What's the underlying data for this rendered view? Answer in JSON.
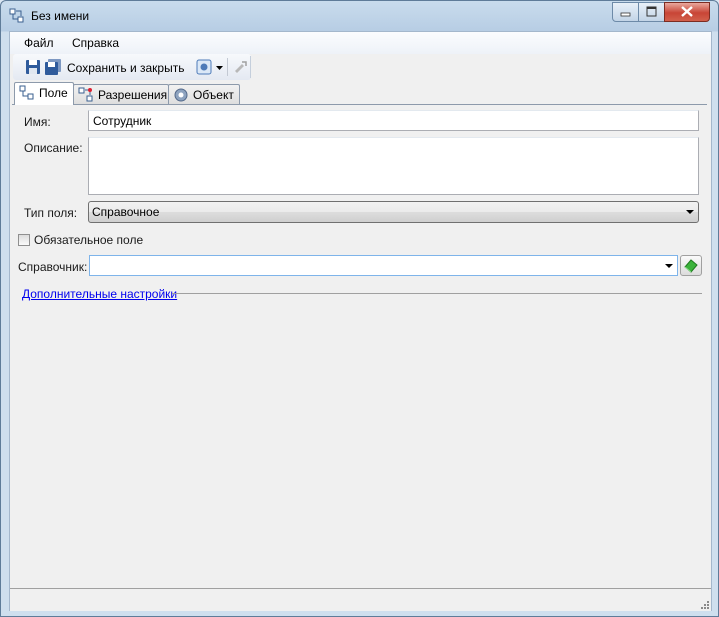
{
  "window": {
    "title": "Без имени"
  },
  "menu": {
    "file": "Файл",
    "help": "Справка"
  },
  "toolbar": {
    "save_close": "Сохранить и закрыть"
  },
  "tabs": [
    {
      "label": "Поле"
    },
    {
      "label": "Разрешения"
    },
    {
      "label": "Объект"
    }
  ],
  "form": {
    "name_label": "Имя:",
    "name_value": "Сотрудник",
    "description_label": "Описание:",
    "description_value": "",
    "field_type_label": "Тип поля:",
    "field_type_value": "Справочное",
    "required_label": "Обязательное поле",
    "required_checked": false,
    "directory_label": "Справочник:",
    "directory_value": "",
    "advanced_link": "Дополнительные настройки"
  }
}
